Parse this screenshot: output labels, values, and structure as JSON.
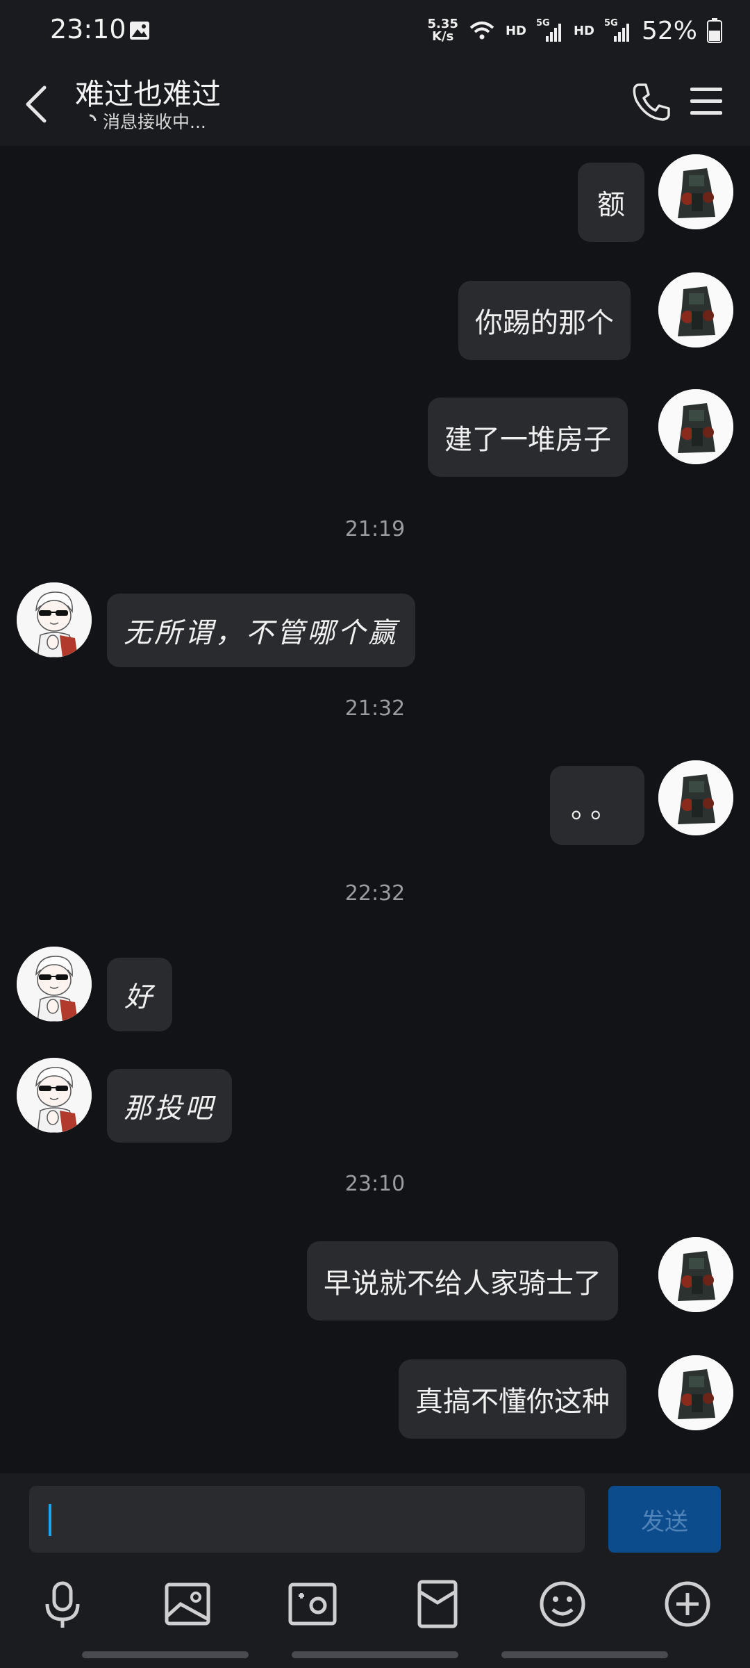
{
  "status": {
    "time": "23:10",
    "net_speed": [
      "5.35",
      "K/s"
    ],
    "hd": "HD",
    "gen": "5G",
    "battery": "52%"
  },
  "header": {
    "title": "难过也难过",
    "subtitle": "消息接收中..."
  },
  "messages": [
    {
      "side": "right",
      "text": "额"
    },
    {
      "side": "right",
      "text": "你踢的那个"
    },
    {
      "side": "right",
      "text": "建了一堆房子"
    },
    {
      "timestamp": "21:19"
    },
    {
      "side": "left",
      "text": "无所谓，不管哪个赢"
    },
    {
      "timestamp": "21:32"
    },
    {
      "side": "right",
      "text": "。。"
    },
    {
      "timestamp": "22:32"
    },
    {
      "side": "left",
      "text": "好"
    },
    {
      "side": "left",
      "text": "那投吧"
    },
    {
      "timestamp": "23:10"
    },
    {
      "side": "right",
      "text": "早说就不给人家骑士了"
    },
    {
      "side": "right",
      "text": "真搞不懂你这种"
    }
  ],
  "input": {
    "value": "",
    "send_label": "发送"
  },
  "toolbar": [
    "mic-icon",
    "image-icon",
    "camera-icon",
    "red-packet-icon",
    "emoji-icon",
    "plus-icon"
  ],
  "colors": {
    "background": "#121316",
    "bubble": "#2a2b2f",
    "send_button": "#0d4c8c",
    "cursor": "#1ba7f0"
  }
}
